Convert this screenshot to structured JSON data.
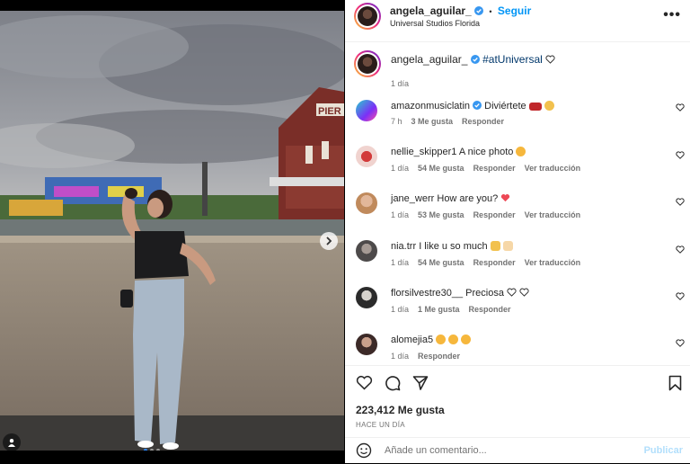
{
  "post": {
    "username": "angela_aguilar_",
    "dot": "•",
    "follow_label": "Seguir",
    "location": "Universal Studios Florida",
    "more_label": "•••"
  },
  "caption": {
    "username": "angela_aguilar_",
    "text": "#atUniversal",
    "time": "1 día"
  },
  "comments": [
    {
      "username": "amazonmusiclatin",
      "verified": true,
      "text": "Diviértete",
      "time": "7 h",
      "likes": "3 Me gusta",
      "reply": "Responder",
      "translate": ""
    },
    {
      "username": "nellie_skipper1",
      "verified": false,
      "text": "A nice photo",
      "time": "1 día",
      "likes": "54 Me gusta",
      "reply": "Responder",
      "translate": "Ver traducción"
    },
    {
      "username": "jane_werr",
      "verified": false,
      "text": "How are you?",
      "time": "1 día",
      "likes": "53 Me gusta",
      "reply": "Responder",
      "translate": "Ver traducción"
    },
    {
      "username": "nia.trr",
      "verified": false,
      "text": "I like u so much",
      "time": "1 día",
      "likes": "54 Me gusta",
      "reply": "Responder",
      "translate": "Ver traducción"
    },
    {
      "username": "florsilvestre30__",
      "verified": false,
      "text": "Preciosa",
      "time": "1 día",
      "likes": "1 Me gusta",
      "reply": "Responder",
      "translate": ""
    },
    {
      "username": "alomejia5",
      "verified": false,
      "text": "",
      "time": "1 día",
      "likes": "",
      "reply": "Responder",
      "translate": ""
    }
  ],
  "likes_count": "223,412 Me gusta",
  "posted_ago": "HACE UN DÍA",
  "add_comment": {
    "placeholder": "Añade un comentario...",
    "publish_label": "Publicar"
  },
  "photo_signage": "PIER",
  "colors": {
    "accent": "#0095f6",
    "text": "#262626",
    "muted": "#737373",
    "verified": "#3897f0",
    "heart_red": "#ed4956"
  },
  "icons": [
    "heart-icon",
    "comment-icon",
    "share-icon",
    "bookmark-icon",
    "emoji-icon",
    "next-arrow-icon",
    "user-tag-icon",
    "verified-icon",
    "more-options-icon"
  ]
}
